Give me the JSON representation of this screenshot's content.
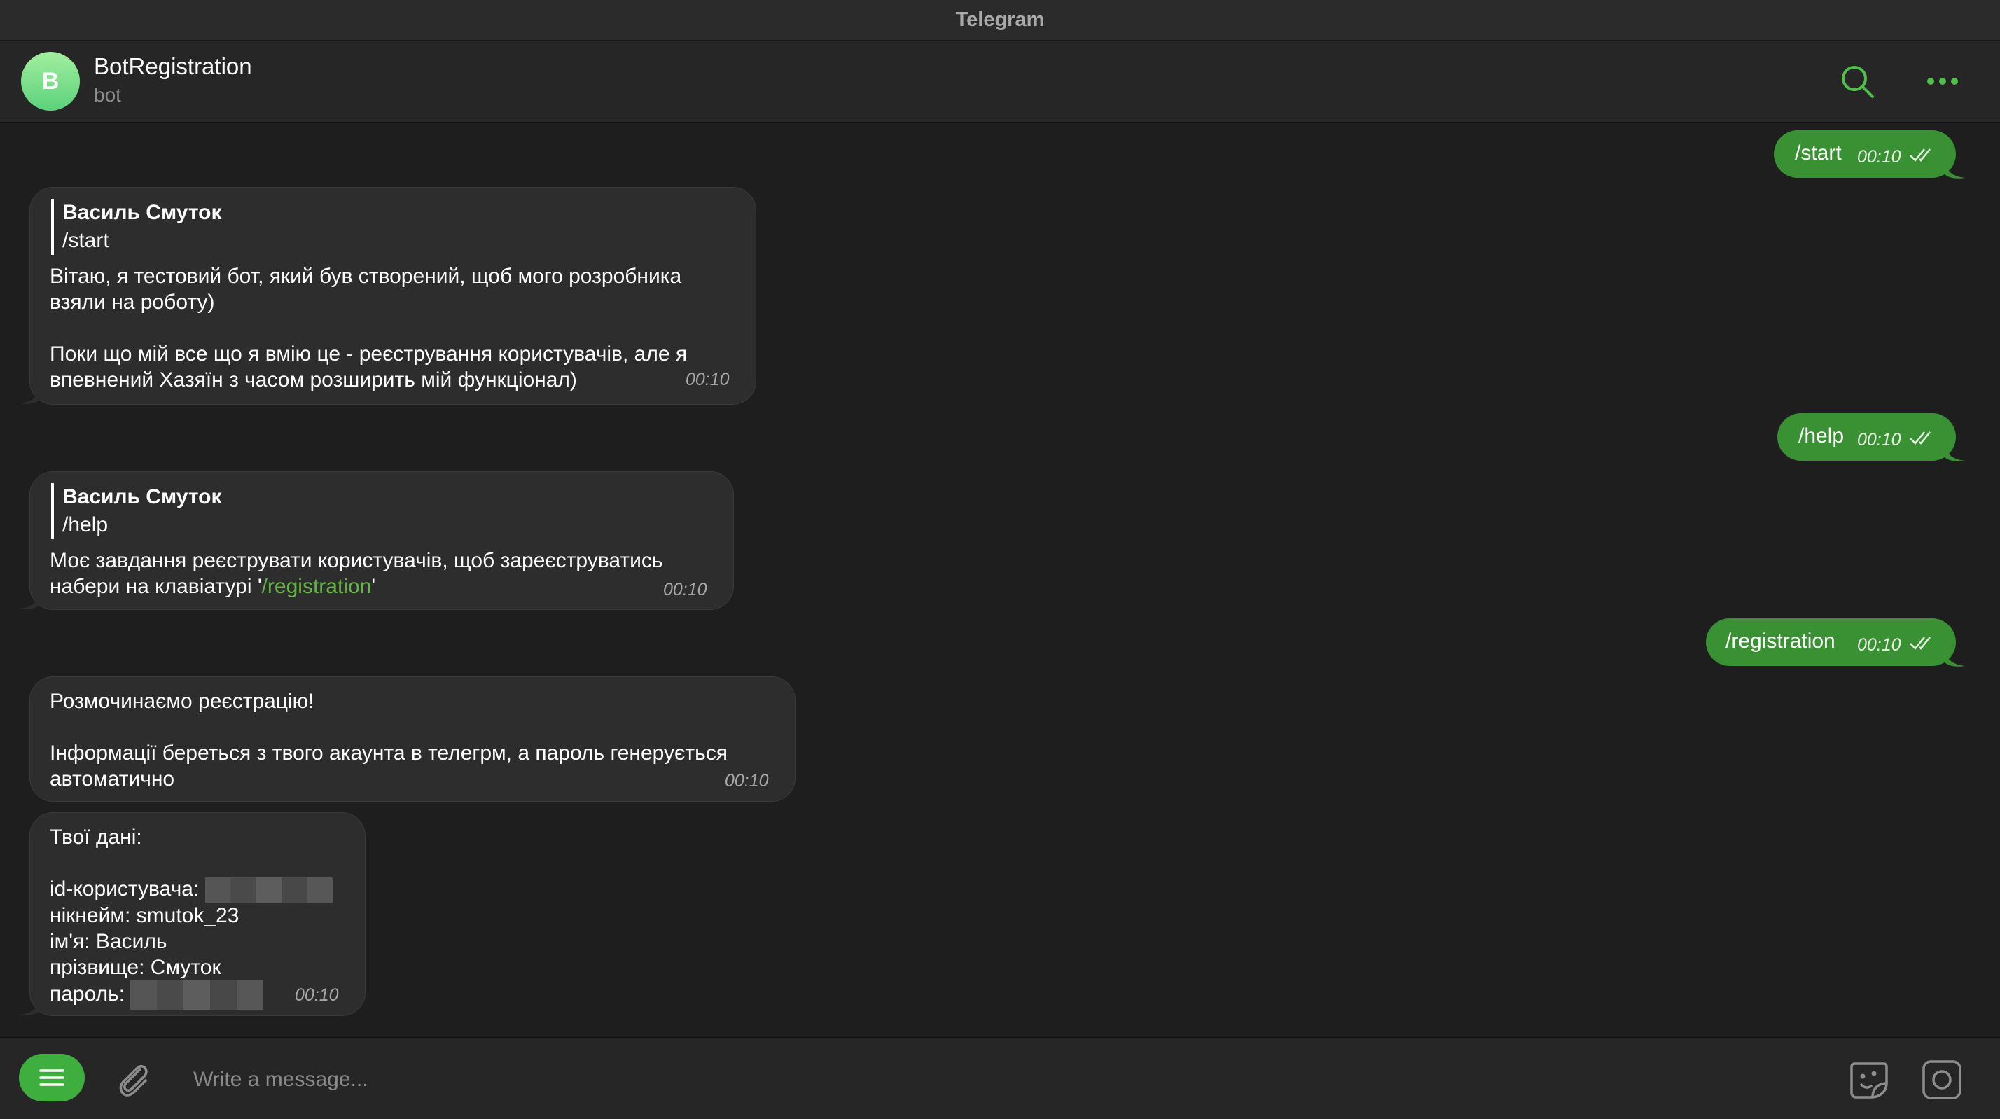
{
  "window": {
    "title": "Telegram"
  },
  "chat": {
    "avatar_letter": "B",
    "name": "BotRegistration",
    "status": "bot"
  },
  "icons": {
    "search": "search-icon",
    "more": "more-icon",
    "menu": "menu-icon",
    "attach": "paperclip-icon",
    "sticker": "sticker-icon",
    "camera": "camera-icon",
    "read": "double-check-icon"
  },
  "colors": {
    "accent": "#3eae3e",
    "outgoing_bubble": "#3a9134",
    "incoming_bubble": "#2d2d2d",
    "link": "#63b544",
    "background": "#1e1e1e"
  },
  "messages": [
    {
      "direction": "out",
      "text": "/start",
      "time": "00:10"
    },
    {
      "direction": "in",
      "reply_name": "Василь Смуток",
      "reply_text": "/start",
      "text": "Вітаю, я тестовий бот, який був створений, щоб мого розробника\nвзяли на роботу)\n\nПоки що мій все що я вмію це - реєстрування користувачів, але я\nвпевнений Хазяїн з часом розширить мій функціонал)",
      "time": "00:10"
    },
    {
      "direction": "out",
      "text": "/help",
      "time": "00:10"
    },
    {
      "direction": "in",
      "reply_name": "Василь Смуток",
      "reply_text": "/help",
      "text_line1": "Моє завдання реєструвати користувачів, щоб зареєструватись",
      "text_line2_prefix": "набери на клавіатурі  '",
      "text_line2_link": "/registration",
      "text_line2_suffix": "'",
      "time": "00:10"
    },
    {
      "direction": "out",
      "text": "/registration",
      "time": "00:10"
    },
    {
      "direction": "in",
      "text": "Розмочинаємо реєстрацію!\n\nІнформації береться з твого акаунта в телегрм, а пароль генерується\nавтоматично",
      "time": "00:10"
    },
    {
      "direction": "in",
      "title": "Твої дані:",
      "id_label": "id-користувача: ",
      "nickname_line": "нікнейм: smutok_23",
      "name_line": "ім'я: Василь",
      "surname_line": "прізвище: Смуток",
      "password_label": "пароль: ",
      "time": "00:10"
    }
  ],
  "composer": {
    "placeholder": "Write a message..."
  }
}
